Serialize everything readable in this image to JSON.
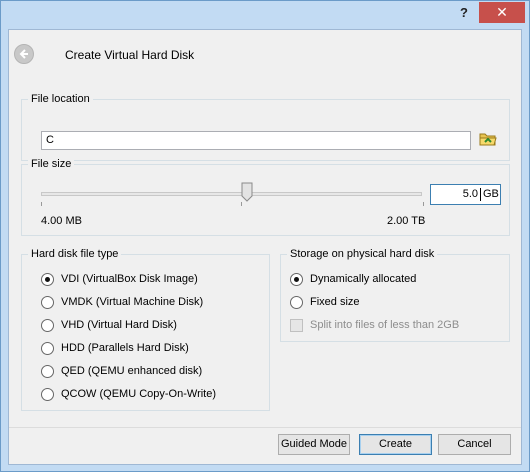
{
  "titlebar": {
    "help_label": "?",
    "close_label": "✕"
  },
  "header": {
    "back_icon": "arrow-left-icon",
    "title": "Create Virtual Hard Disk"
  },
  "file_location": {
    "group_title": "File location",
    "value": "C",
    "browse_icon": "folder-browse-icon"
  },
  "file_size": {
    "group_title": "File size",
    "value": "5.0",
    "unit": "GB",
    "min_label": "4.00 MB",
    "max_label": "2.00 TB",
    "slider_fraction": 0.54
  },
  "disk_type": {
    "group_title": "Hard disk file type",
    "options": [
      {
        "label": "VDI (VirtualBox Disk Image)",
        "checked": true
      },
      {
        "label": "VMDK (Virtual Machine Disk)",
        "checked": false
      },
      {
        "label": "VHD (Virtual Hard Disk)",
        "checked": false
      },
      {
        "label": "HDD (Parallels Hard Disk)",
        "checked": false
      },
      {
        "label": "QED (QEMU enhanced disk)",
        "checked": false
      },
      {
        "label": "QCOW (QEMU Copy-On-Write)",
        "checked": false
      }
    ]
  },
  "storage": {
    "group_title": "Storage on physical hard disk",
    "options": [
      {
        "label": "Dynamically allocated",
        "checked": true
      },
      {
        "label": "Fixed size",
        "checked": false
      }
    ],
    "split_label": "Split into files of less than 2GB",
    "split_checked": false,
    "split_enabled": false
  },
  "buttons": {
    "guided": "Guided Mode",
    "create": "Create",
    "cancel": "Cancel"
  },
  "colors": {
    "frame": "#c2dbf3",
    "close": "#c7504b",
    "focus": "#3c7fb1"
  }
}
